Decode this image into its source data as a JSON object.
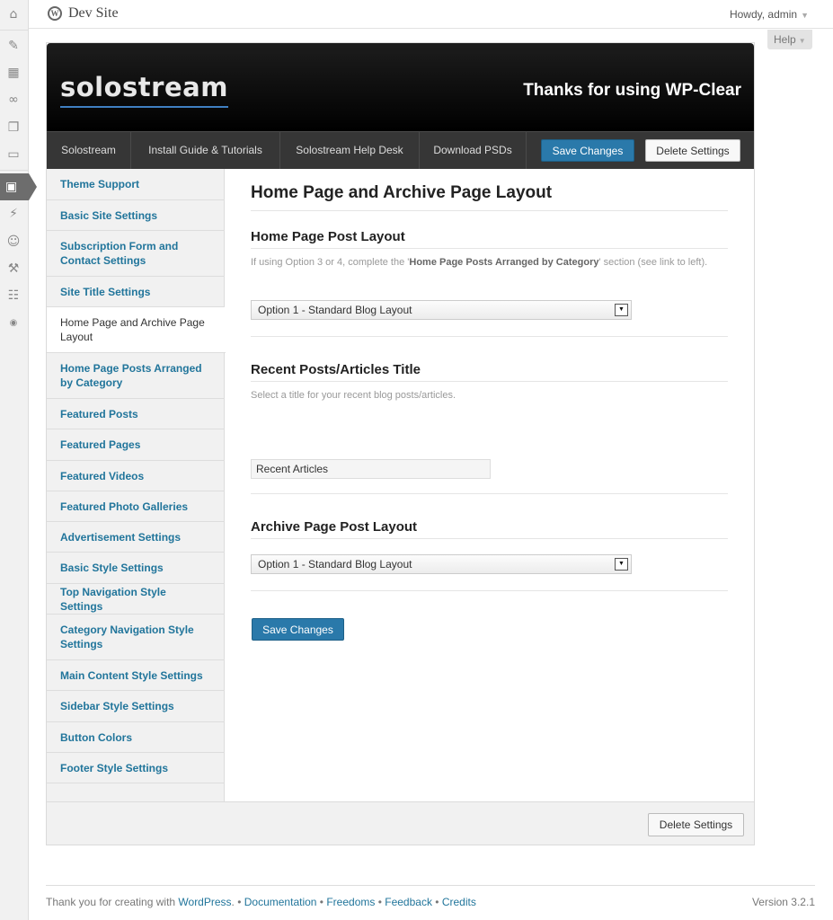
{
  "rail": {
    "icons": [
      "dashboard-icon",
      "posts-icon",
      "media-icon",
      "links-icon",
      "pages-icon",
      "comments-icon",
      "appearance-icon",
      "plugins-icon",
      "users-icon",
      "tools-icon",
      "settings-icon",
      "collapse-icon"
    ]
  },
  "header": {
    "site_title": "Dev Site",
    "howdy": "Howdy, admin",
    "help": "Help"
  },
  "banner": {
    "brand": "solostream",
    "thanks": "Thanks for using WP-Clear"
  },
  "topnav": {
    "links": [
      "Solostream",
      "Install Guide & Tutorials",
      "Solostream Help Desk",
      "Download PSDs"
    ],
    "save_label": "Save Changes",
    "delete_label": "Delete Settings"
  },
  "sidebar": {
    "items": [
      "Theme Support",
      "Basic Site Settings",
      "Subscription Form and Contact Settings",
      "Site Title Settings",
      "Home Page and Archive Page Layout",
      "Home Page Posts Arranged by Category",
      "Featured Posts",
      "Featured Pages",
      "Featured Videos",
      "Featured Photo Galleries",
      "Advertisement Settings",
      "Basic Style Settings",
      "Top Navigation Style Settings",
      "Category Navigation Style Settings",
      "Main Content Style Settings",
      "Sidebar Style Settings",
      "Button Colors",
      "Footer Style Settings"
    ],
    "current_index": 4
  },
  "main": {
    "heading": "Home Page and Archive Page Layout",
    "home_layout": {
      "title": "Home Page Post Layout",
      "desc_pre": "If using Option 3 or 4, complete the '",
      "desc_bold": "Home Page Posts Arranged by Category",
      "desc_post": "' section (see link to left).",
      "selected": "Option 1 - Standard Blog Layout"
    },
    "recent_title": {
      "title": "Recent Posts/Articles Title",
      "desc": "Select a title for your recent blog posts/articles.",
      "value": "Recent Articles"
    },
    "archive_layout": {
      "title": "Archive Page Post Layout",
      "selected": "Option 1 - Standard Blog Layout"
    },
    "save_label": "Save Changes"
  },
  "panel_footer": {
    "delete_label": "Delete Settings"
  },
  "footer": {
    "thanks_pre": "Thank you for creating with ",
    "wordpress": "WordPress",
    "documentation": "Documentation",
    "freedoms": "Freedoms",
    "feedback": "Feedback",
    "credits": "Credits",
    "version": "Version 3.2.1"
  }
}
